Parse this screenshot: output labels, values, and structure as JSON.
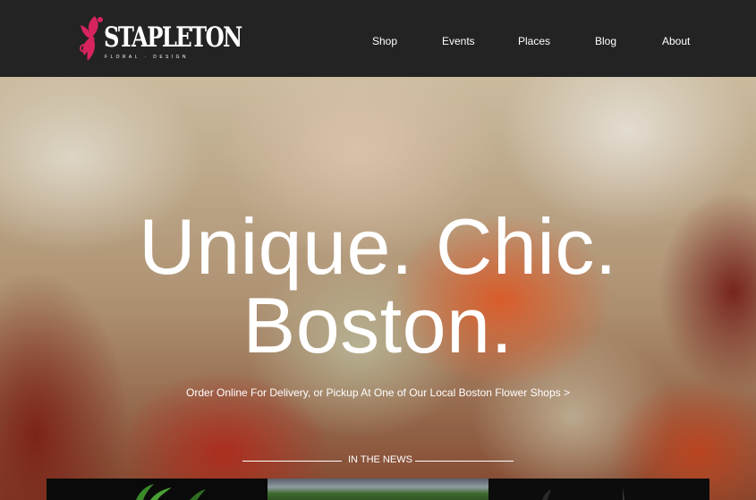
{
  "header": {
    "logo": {
      "name": "STAPLETON",
      "sub": "FLORAL · DESIGN"
    },
    "nav": [
      {
        "label": "Shop"
      },
      {
        "label": "Events"
      },
      {
        "label": "Places"
      },
      {
        "label": "Blog"
      },
      {
        "label": "About"
      }
    ]
  },
  "hero": {
    "headline_line1": "Unique. Chic.",
    "headline_line2": "Boston.",
    "cta": "Order Online For Delivery, or Pickup At One of Our Local Boston Flower Shops >",
    "news_heading": "IN THE NEWS"
  },
  "colors": {
    "topbar": "#232323",
    "logo_accent": "#d8245e",
    "text": "#ffffff"
  }
}
